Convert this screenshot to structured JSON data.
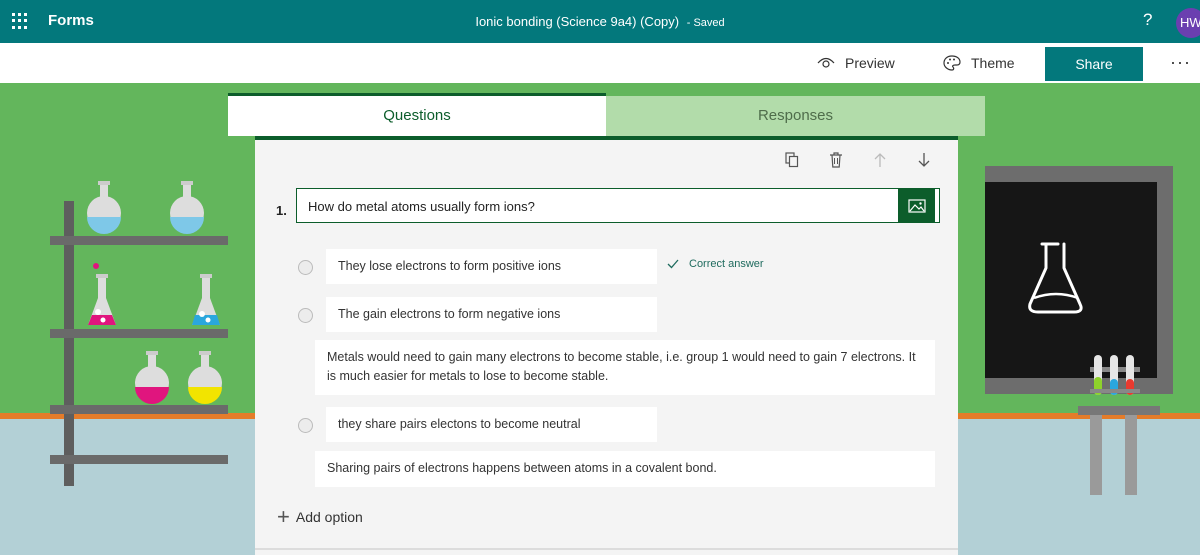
{
  "header": {
    "app_name": "Forms",
    "form_title": "Ionic bonding (Science 9a4) (Copy)",
    "save_status": "- Saved",
    "help_label": "?",
    "user_initials": "HW",
    "colors": {
      "brand": "#03787c",
      "accent": "#0c5d2b"
    }
  },
  "commands": {
    "preview_label": "Preview",
    "theme_label": "Theme",
    "share_label": "Share",
    "more_label": "···"
  },
  "tabs": {
    "questions_label": "Questions",
    "responses_label": "Responses",
    "active": "Questions"
  },
  "question": {
    "number": "1.",
    "text": "How do metal atoms usually form ions?",
    "toolbar_icons": [
      "copy-icon",
      "delete-icon",
      "move-up-icon",
      "move-down-icon"
    ],
    "insert_media_icon": "image-icon",
    "options": [
      {
        "label": "They lose electrons to form positive ions",
        "correct": true,
        "correct_label": "Correct answer",
        "feedback": ""
      },
      {
        "label": "The gain electrons to form negative ions",
        "correct": false,
        "feedback": "Metals would need to gain many electrons to become stable, i.e. group 1 would need to gain 7 electrons. It is much easier for metals to lose to become stable."
      },
      {
        "label": "they share pairs electons to become neutral",
        "correct": false,
        "feedback": "Sharing pairs of electrons happens between atoms in a covalent bond."
      }
    ],
    "add_option_label": "Add option"
  }
}
